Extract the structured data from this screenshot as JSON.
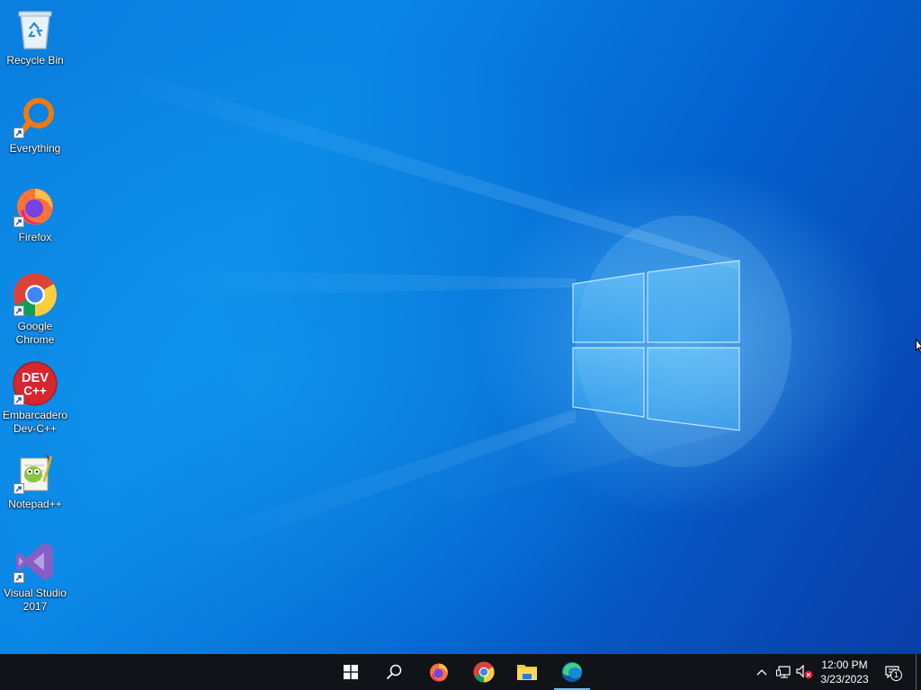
{
  "desktop": {
    "icons": [
      {
        "label": "Recycle Bin",
        "icon": "recycle-bin-icon",
        "shortcut": false
      },
      {
        "label": "Everything",
        "icon": "everything-search-icon",
        "shortcut": true
      },
      {
        "label": "Firefox",
        "icon": "firefox-icon",
        "shortcut": true
      },
      {
        "label": "Google\nChrome",
        "icon": "chrome-icon",
        "shortcut": true
      },
      {
        "label": "Embarcadero\nDev-C++",
        "icon": "devcpp-icon",
        "shortcut": true,
        "icon_text_top": "DEV",
        "icon_text_bottom": "C++"
      },
      {
        "label": "Notepad++",
        "icon": "notepadpp-icon",
        "shortcut": true
      },
      {
        "label": "Visual Studio\n2017",
        "icon": "visual-studio-icon",
        "shortcut": true
      }
    ]
  },
  "taskbar": {
    "buttons": [
      {
        "name": "start",
        "icon": "windows-start-icon",
        "active": false
      },
      {
        "name": "search",
        "icon": "search-icon",
        "active": false
      },
      {
        "name": "firefox",
        "icon": "firefox-icon",
        "active": false
      },
      {
        "name": "chrome",
        "icon": "chrome-icon",
        "active": false
      },
      {
        "name": "file-explorer",
        "icon": "folder-icon",
        "active": false
      },
      {
        "name": "edge",
        "icon": "edge-icon",
        "active": true
      }
    ],
    "tray": {
      "icons": [
        "chevron-up-icon",
        "network-icon",
        "volume-muted-icon"
      ],
      "time": "12:00 PM",
      "date": "3/23/2023",
      "notification_count": "1"
    }
  },
  "colors": {
    "taskbar_bg": "#101418",
    "active_indicator": "#76b9ed",
    "wallpaper_base": "#0a7fe0"
  }
}
